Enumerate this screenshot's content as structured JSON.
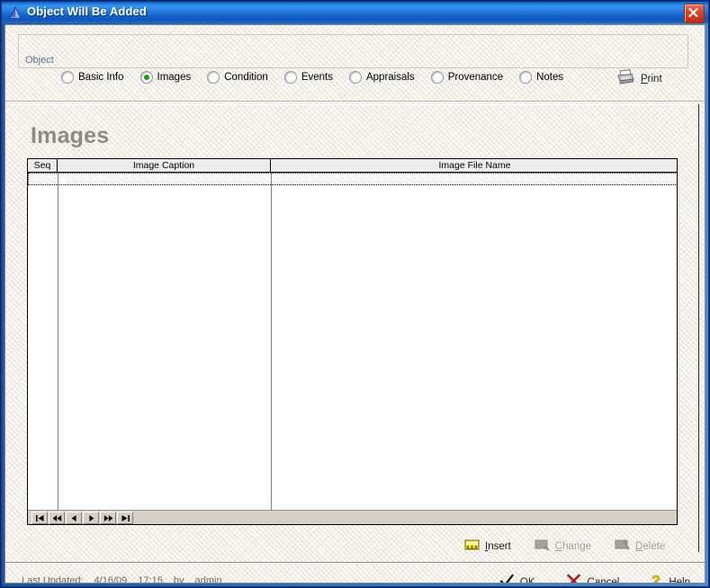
{
  "window": {
    "title": "Object Will Be Added",
    "icon": "triangle-icon",
    "close_icon": "close-icon"
  },
  "toolbar": {
    "group_label": "Object",
    "tabs": [
      {
        "label": "Basic Info",
        "selected": false
      },
      {
        "label": "Images",
        "selected": true
      },
      {
        "label": "Condition",
        "selected": false
      },
      {
        "label": "Events",
        "selected": false
      },
      {
        "label": "Appraisals",
        "selected": false
      },
      {
        "label": "Provenance",
        "selected": false
      },
      {
        "label": "Notes",
        "selected": false
      }
    ],
    "print": {
      "label": "Print",
      "accel": "P",
      "rest": "rint",
      "icon": "printer-icon"
    }
  },
  "main": {
    "heading": "Images",
    "grid": {
      "columns": [
        "Seq",
        "Image Caption",
        "Image File Name"
      ],
      "rows": [],
      "nav": [
        {
          "name": "first-record-button",
          "icon": "first-icon"
        },
        {
          "name": "fast-rewind-button",
          "icon": "fast-rewind-icon"
        },
        {
          "name": "previous-record-button",
          "icon": "previous-icon"
        },
        {
          "name": "next-record-button",
          "icon": "next-icon"
        },
        {
          "name": "fast-forward-button",
          "icon": "fast-forward-icon"
        },
        {
          "name": "last-record-button",
          "icon": "last-icon"
        }
      ]
    },
    "record_actions": [
      {
        "accel": "I",
        "rest": "nsert",
        "label": "Insert",
        "enabled": true,
        "icon": "insert-icon"
      },
      {
        "accel": "C",
        "rest": "hange",
        "label": "Change",
        "enabled": false,
        "icon": "change-icon"
      },
      {
        "accel": "D",
        "rest": "elete",
        "label": "Delete",
        "enabled": false,
        "icon": "delete-icon"
      }
    ]
  },
  "status": {
    "label": "Last Updated:",
    "date": "4/16/09",
    "time": "17:15",
    "by": "by",
    "user": "admin"
  },
  "dialog_buttons": [
    {
      "accel": "O",
      "rest": "K",
      "label": "OK",
      "icon": "check-icon"
    },
    {
      "accel": "C",
      "rest": "ancel",
      "label": "Cancel",
      "icon": "x-icon"
    },
    {
      "accel": "H",
      "rest": "elp",
      "label": "Help",
      "icon": "question-icon"
    }
  ],
  "colors": {
    "title_bar": "#1f76dc",
    "close_button": "#d8482c",
    "selected_radio": "#1a9c1a",
    "heading": "#8d8b82",
    "background": "#eae6db"
  }
}
